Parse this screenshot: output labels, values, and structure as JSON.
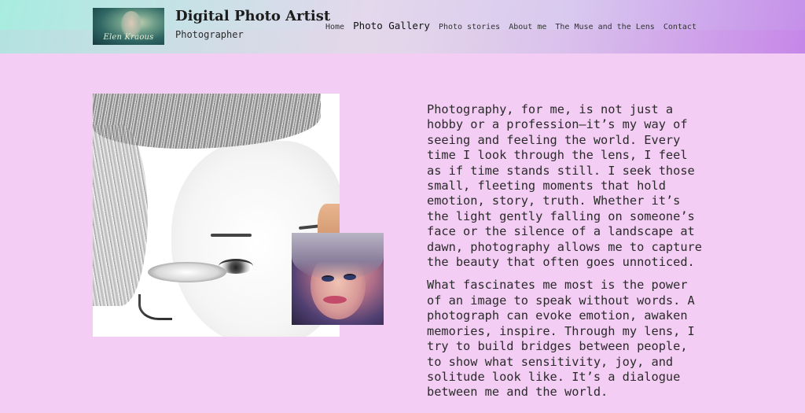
{
  "header": {
    "logo_text": "Elen Kraous",
    "site_title": "Digital Photo Artist",
    "tagline": "Photographer"
  },
  "nav": {
    "items": [
      {
        "label": "Home",
        "active": false
      },
      {
        "label": "Photo Gallery",
        "active": true
      },
      {
        "label": "Photo stories",
        "active": false
      },
      {
        "label": "About me",
        "active": false
      },
      {
        "label": "The Muse and the Lens",
        "active": false
      },
      {
        "label": "Contact",
        "active": false
      }
    ]
  },
  "main": {
    "paragraphs": [
      "Photography, for me, is not just a hobby or a profession—it’s my way of seeing and feeling the world. Every time I look through the lens, I feel as if time stands still. I seek those small, fleeting moments that hold emotion, story, truth. Whether it’s the light gently falling on someone’s face or the silence of a landscape at dawn, photography allows me to capture the beauty that often goes unnoticed.",
      "What fascinates me most is the power of an image to speak without words. A photograph can evoke emotion, awaken memories, inspire. Through my lens, I try to build bridges between people, to show what sensitivity, joy, and solitude look like. It’s a dialogue between me and the world."
    ]
  },
  "colors": {
    "page_background": "#f3cdf3",
    "header_gradient_start": "#a8ece0",
    "header_gradient_end": "#c58fe9",
    "text": "#2a2a2a"
  }
}
